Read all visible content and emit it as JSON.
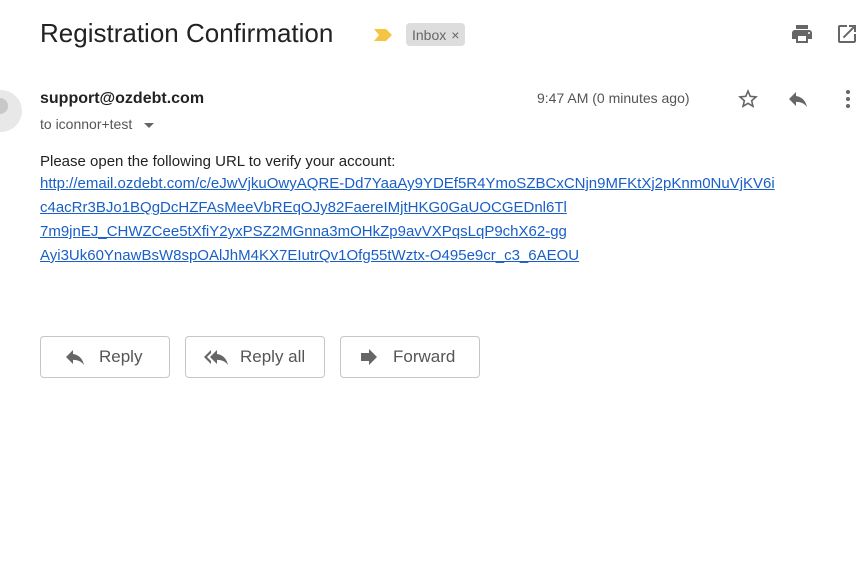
{
  "email": {
    "subject": "Registration Confirmation",
    "label": "Inbox",
    "label_close": "×",
    "sender": "support@ozdebt.com",
    "recipient": "to iconnor+test",
    "timestamp": "9:47 AM (0 minutes ago)",
    "body_intro": "Please open the following URL to verify your account:",
    "link_lines": [
      "http://email.ozdebt.com/c/eJwVjkuOwyAQRE-Dd7YaaAy9YDEf5R4YmoSZBCxCNjn9MFKtXj2pKnm0NuVjKV6i",
      "c4acRr3BJo1BQgDcHZFAsMeeVbREqOJy82FaereIMjtHKG0GaUOCGEDnl6Tl",
      "7m9jnEJ_CHWZCee5tXfiY2yxPSZ2MGnna3mOHkZp9avVXPqsLqP9chX62-gg",
      "Ayi3Uk60YnawBsW8spOAlJhM4KX7EIutrQv1Ofg55tWztx-O495e9cr_c3_6AEOU"
    ]
  },
  "actions": {
    "reply": "Reply",
    "reply_all": "Reply all",
    "forward": "Forward"
  },
  "colors": {
    "link": "#1a5fc7",
    "importance_marker": "#f4c542",
    "chip_bg": "#dddddd"
  }
}
